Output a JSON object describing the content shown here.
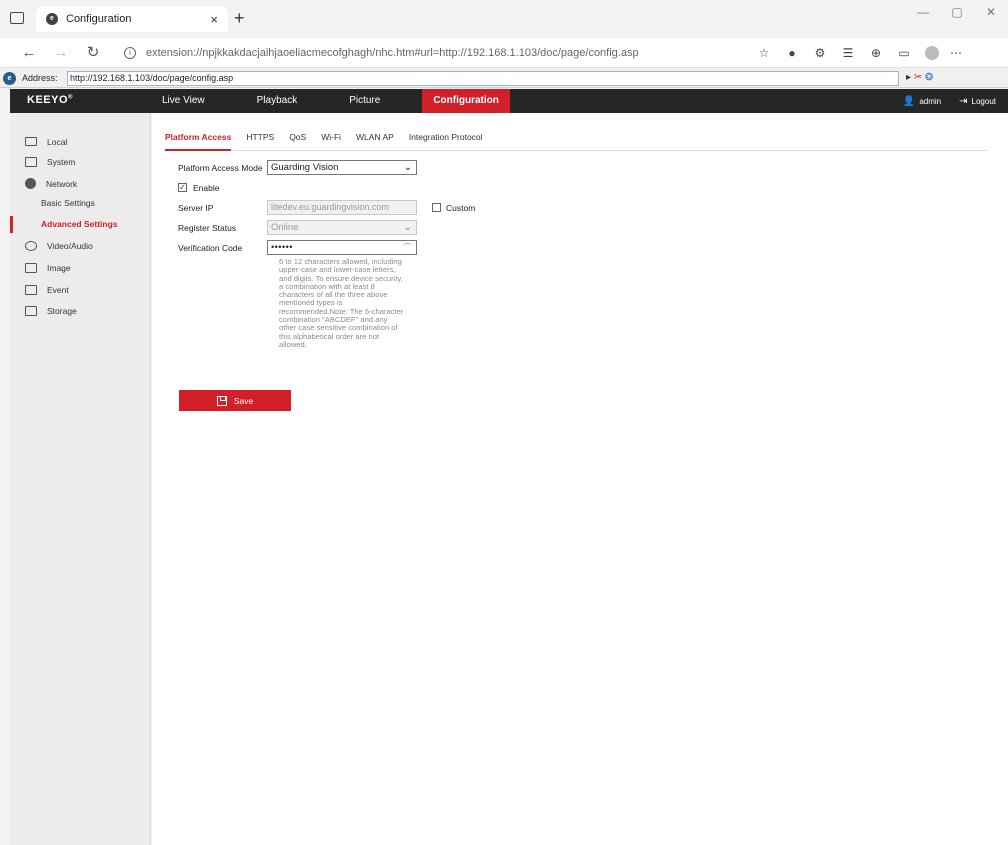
{
  "browser": {
    "tab_title": "Configuration",
    "tab_close": "×",
    "new_tab": "+",
    "url": "extension://npjkkakdacjaihjaoeliacmecofghagh/nhc.htm#url=http://192.168.1.103/doc/page/config.asp",
    "address_label": "Address:",
    "address_value": "http://192.168.1.103/doc/page/config.asp"
  },
  "header": {
    "brand": "KEEYO",
    "brand_mark": "®",
    "nav": [
      "Live View",
      "Playback",
      "Picture",
      "Configuration"
    ],
    "active_nav": "Configuration",
    "user": "admin",
    "logout": "Logout"
  },
  "sidebar": {
    "items": [
      {
        "label": "Local",
        "icon": "monitor-icon"
      },
      {
        "label": "System",
        "icon": "system-icon"
      },
      {
        "label": "Network",
        "icon": "network-globe-icon"
      },
      {
        "label": "Basic Settings"
      },
      {
        "label": "Advanced Settings"
      },
      {
        "label": "Video/Audio",
        "icon": "video-audio-icon"
      },
      {
        "label": "Image",
        "icon": "image-icon"
      },
      {
        "label": "Event",
        "icon": "event-icon"
      },
      {
        "label": "Storage",
        "icon": "storage-icon"
      }
    ],
    "active": "Advanced Settings"
  },
  "tabs": [
    "Platform Access",
    "HTTPS",
    "QoS",
    "Wi-Fi",
    "WLAN AP",
    "Integration Protocol"
  ],
  "active_tab": "Platform Access",
  "form": {
    "mode_label": "Platform Access Mode",
    "mode_value": "Guarding Vision",
    "enable_label": "Enable",
    "enable_checked": true,
    "server_ip_label": "Server IP",
    "server_ip_value": "litedev.eu.guardingvision.com",
    "custom_label": "Custom",
    "custom_checked": false,
    "register_status_label": "Register Status",
    "register_status_value": "Online",
    "verification_label": "Verification Code",
    "verification_value": "••••••",
    "hint_lines": [
      "6 to 12 characters allowed, including",
      "upper-case and lower-case letters,",
      "and digits. To ensure device security,",
      "a combination with at least 8",
      "characters of all the three above",
      "mentioned types is",
      "recommended.Note: The 6-character",
      "combination \"ABCDEF\" and any",
      "other case sensitive combination of",
      "this alphabetical order are not",
      "allowed."
    ],
    "save_label": "Save"
  },
  "colors": {
    "accent": "#d1202a",
    "header_bg": "#262626",
    "sidebar_bg": "#ececec"
  }
}
